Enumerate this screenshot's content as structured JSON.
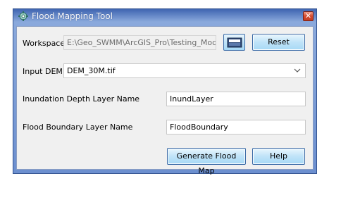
{
  "window": {
    "title": "Flood Mapping Tool",
    "close_glyph": "✕",
    "app_icon": "gear-icon"
  },
  "workspace": {
    "label": "Workspace",
    "value": "E:\\Geo_SWMM\\ArcGIS_Pro\\Testing_Models\\",
    "browse_icon": "folder-icon",
    "reset_label": "Reset"
  },
  "dem": {
    "label": "Input DEM",
    "selected": "DEM_30M.tif"
  },
  "inundation": {
    "label": "Inundation Depth Layer Name",
    "value": "InundLayer"
  },
  "boundary": {
    "label": "Flood Boundary Layer Name",
    "value": "FloodBoundary"
  },
  "buttons": {
    "generate_label": "Generate Flood Map",
    "help_label": "Help"
  },
  "colors": {
    "title_bar": "#3f65b1",
    "close_button": "#d54b2f",
    "button_face": "#bfe3f8"
  }
}
